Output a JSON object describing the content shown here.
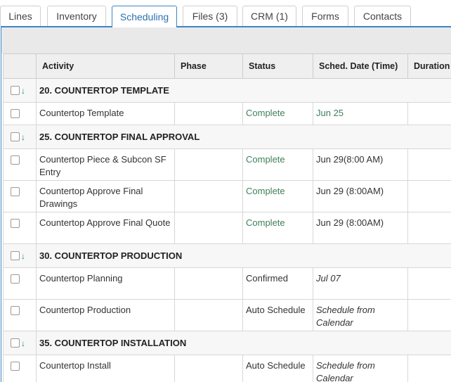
{
  "tabs": [
    {
      "label": "Lines",
      "active": false
    },
    {
      "label": "Inventory",
      "active": false
    },
    {
      "label": "Scheduling",
      "active": true
    },
    {
      "label": "Files (3)",
      "active": false
    },
    {
      "label": "CRM (1)",
      "active": false
    },
    {
      "label": "Forms",
      "active": false
    },
    {
      "label": "Contacts",
      "active": false
    }
  ],
  "columns": {
    "activity": "Activity",
    "phase": "Phase",
    "status": "Status",
    "sched_date": "Sched. Date (Time)",
    "duration": "Duration"
  },
  "groups": [
    {
      "title": "20. COUNTERTOP TEMPLATE",
      "items": [
        {
          "activity": "Countertop Template",
          "phase": "",
          "status": "Complete",
          "date": "Jun 25"
        }
      ]
    },
    {
      "title": "25. COUNTERTOP FINAL APPROVAL",
      "items": [
        {
          "activity": "Countertop Piece & Subcon SF Entry",
          "phase": "",
          "status": "Complete",
          "date": "Jun 29(8:00 AM)"
        },
        {
          "activity": "Countertop Approve Final Drawings",
          "phase": "",
          "status": "Complete",
          "date": "Jun 29 (8:00AM)"
        },
        {
          "activity": "Countertop Approve Final Quote",
          "phase": "",
          "status": "Complete",
          "date": "Jun 29 (8:00AM)"
        }
      ]
    },
    {
      "title": "30. COUNTERTOP PRODUCTION",
      "items": [
        {
          "activity": "Countertop Planning",
          "phase": "",
          "status": "Confirmed",
          "date": "Jul 07"
        },
        {
          "activity": "Countertop Production",
          "phase": "",
          "status": "Auto Schedule",
          "date": "Schedule from Calendar"
        }
      ]
    },
    {
      "title": "35. COUNTERTOP INSTALLATION",
      "items": [
        {
          "activity": "Countertop Install",
          "phase": "",
          "status": "Auto Schedule",
          "date": "Schedule from Calendar"
        }
      ]
    }
  ],
  "icons": {
    "collapse": "arrow-down-icon",
    "checkbox": "checkbox-icon"
  },
  "colors": {
    "accent": "#3d84c6",
    "complete": "#3f7f5a",
    "arrow": "#2b8a57"
  }
}
